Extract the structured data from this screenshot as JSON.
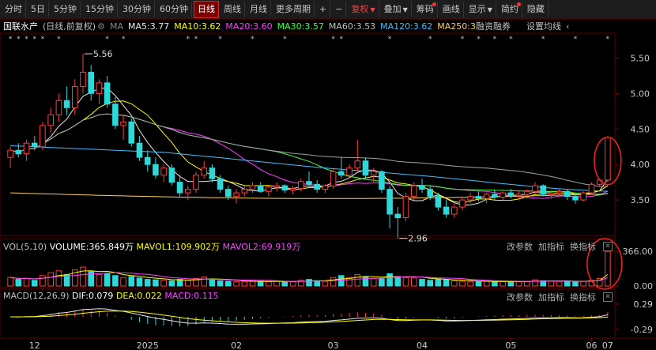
{
  "toolbar": {
    "periods": [
      "分时",
      "5日",
      "5分钟",
      "15分钟",
      "30分钟",
      "60分钟",
      "日线",
      "周线",
      "月线",
      "更多周期"
    ],
    "active_period": "日线",
    "plus": "+",
    "minus": "−",
    "restore_label": "复权",
    "overlay_label": "叠加",
    "chips_label": "筹码",
    "draw_label": "画线",
    "display_label": "显示",
    "simple_label": "简约",
    "hide_label": "隐藏"
  },
  "info": {
    "stock_name": "国联水产",
    "mode": "(日线,前复权)",
    "ma_label": "MA",
    "ma5": "MA5:3.77",
    "ma10": "MA10:3.62",
    "ma20": "MA20:3.60",
    "ma30": "MA30:3.57",
    "ma60": "MA60:3.53",
    "ma120": "MA120:3.62",
    "ma250": "MA250:3",
    "margin": "融资融券",
    "settings": "设置均线"
  },
  "colors": {
    "up": "#ff3c3c",
    "down": "#2ed8d8",
    "ma5": "#e8e8e8",
    "ma10": "#ffff00",
    "ma20": "#ff40ff",
    "ma30": "#40ff40",
    "ma60": "#a0a0a0",
    "ma120": "#40c0ff",
    "ma250": "#ffd060"
  },
  "chart_data": {
    "type": "candlestick",
    "y_ticks": [
      "5.50",
      "5.00",
      "4.50",
      "4.00",
      "3.50"
    ],
    "ylim": [
      3.0,
      5.85
    ],
    "x_labels": [
      "12",
      "2025",
      "02",
      "03",
      "04",
      "05",
      "06",
      "07"
    ],
    "annotations": [
      "5.56",
      "2.96"
    ],
    "ohlc": [
      [
        4.1,
        4.25,
        3.95,
        4.2
      ],
      [
        4.2,
        4.3,
        4.1,
        4.15
      ],
      [
        4.15,
        4.35,
        4.05,
        4.3
      ],
      [
        4.3,
        4.4,
        4.2,
        4.25
      ],
      [
        4.25,
        4.6,
        4.2,
        4.55
      ],
      [
        4.55,
        4.8,
        4.45,
        4.7
      ],
      [
        4.7,
        5.0,
        4.6,
        4.9
      ],
      [
        4.9,
        5.1,
        4.7,
        4.8
      ],
      [
        4.8,
        5.2,
        4.7,
        5.1
      ],
      [
        5.1,
        5.56,
        5.0,
        5.3
      ],
      [
        5.3,
        5.4,
        4.9,
        5.0
      ],
      [
        5.0,
        5.2,
        4.85,
        5.15
      ],
      [
        5.15,
        5.25,
        4.8,
        4.85
      ],
      [
        4.85,
        4.95,
        4.5,
        4.55
      ],
      [
        4.55,
        4.7,
        4.35,
        4.6
      ],
      [
        4.6,
        4.65,
        4.25,
        4.3
      ],
      [
        4.3,
        4.4,
        4.05,
        4.1
      ],
      [
        4.1,
        4.2,
        3.9,
        4.0
      ],
      [
        4.0,
        4.1,
        3.8,
        3.85
      ],
      [
        3.85,
        4.0,
        3.75,
        3.95
      ],
      [
        3.95,
        4.0,
        3.7,
        3.75
      ],
      [
        3.75,
        3.85,
        3.55,
        3.6
      ],
      [
        3.6,
        3.7,
        3.5,
        3.65
      ],
      [
        3.65,
        3.9,
        3.6,
        3.85
      ],
      [
        3.85,
        4.05,
        3.8,
        3.95
      ],
      [
        3.95,
        4.0,
        3.75,
        3.8
      ],
      [
        3.8,
        3.85,
        3.6,
        3.65
      ],
      [
        3.65,
        3.7,
        3.5,
        3.55
      ],
      [
        3.55,
        3.65,
        3.45,
        3.6
      ],
      [
        3.6,
        3.7,
        3.55,
        3.65
      ],
      [
        3.65,
        3.75,
        3.6,
        3.7
      ],
      [
        3.7,
        3.75,
        3.6,
        3.62
      ],
      [
        3.62,
        3.7,
        3.55,
        3.68
      ],
      [
        3.68,
        3.75,
        3.62,
        3.7
      ],
      [
        3.7,
        3.72,
        3.6,
        3.64
      ],
      [
        3.64,
        3.7,
        3.58,
        3.66
      ],
      [
        3.66,
        3.8,
        3.62,
        3.76
      ],
      [
        3.76,
        3.9,
        3.7,
        3.72
      ],
      [
        3.72,
        3.78,
        3.6,
        3.65
      ],
      [
        3.65,
        3.72,
        3.6,
        3.7
      ],
      [
        3.7,
        3.95,
        3.66,
        3.9
      ],
      [
        3.9,
        4.1,
        3.8,
        3.85
      ],
      [
        3.85,
        4.0,
        3.8,
        3.95
      ],
      [
        3.95,
        4.35,
        3.9,
        4.05
      ],
      [
        4.05,
        4.1,
        3.8,
        3.85
      ],
      [
        3.85,
        3.95,
        3.75,
        3.9
      ],
      [
        3.9,
        3.92,
        3.6,
        3.65
      ],
      [
        3.65,
        3.7,
        3.1,
        3.3
      ],
      [
        3.3,
        3.4,
        2.96,
        3.25
      ],
      [
        3.25,
        3.6,
        3.2,
        3.55
      ],
      [
        3.55,
        3.75,
        3.5,
        3.7
      ],
      [
        3.7,
        3.8,
        3.6,
        3.65
      ],
      [
        3.65,
        3.7,
        3.5,
        3.55
      ],
      [
        3.55,
        3.6,
        3.35,
        3.4
      ],
      [
        3.4,
        3.5,
        3.25,
        3.3
      ],
      [
        3.3,
        3.45,
        3.25,
        3.4
      ],
      [
        3.4,
        3.55,
        3.35,
        3.5
      ],
      [
        3.5,
        3.6,
        3.45,
        3.55
      ],
      [
        3.55,
        3.62,
        3.48,
        3.52
      ],
      [
        3.52,
        3.6,
        3.45,
        3.58
      ],
      [
        3.58,
        3.65,
        3.5,
        3.54
      ],
      [
        3.54,
        3.62,
        3.5,
        3.6
      ],
      [
        3.6,
        3.66,
        3.52,
        3.56
      ],
      [
        3.56,
        3.62,
        3.5,
        3.58
      ],
      [
        3.58,
        3.65,
        3.55,
        3.62
      ],
      [
        3.62,
        3.75,
        3.58,
        3.7
      ],
      [
        3.7,
        3.72,
        3.55,
        3.58
      ],
      [
        3.58,
        3.64,
        3.52,
        3.6
      ],
      [
        3.6,
        3.66,
        3.55,
        3.62
      ],
      [
        3.62,
        3.65,
        3.5,
        3.55
      ],
      [
        3.55,
        3.6,
        3.45,
        3.5
      ],
      [
        3.5,
        3.62,
        3.48,
        3.6
      ],
      [
        3.6,
        3.75,
        3.58,
        3.72
      ],
      [
        3.72,
        3.8,
        3.68,
        3.78
      ],
      [
        3.78,
        4.4,
        3.75,
        4.38
      ]
    ],
    "volume": {
      "label": "VOL(5,10)",
      "volume": "VOLUME:365.849万",
      "mavol1": "MAVOL1:109.902万",
      "mavol2": "MAVOL2:69.919万",
      "y_ticks": [
        "366.00",
        "0.00"
      ],
      "values": [
        90,
        70,
        80,
        60,
        110,
        140,
        160,
        120,
        170,
        200,
        150,
        120,
        130,
        110,
        90,
        100,
        85,
        70,
        65,
        60,
        55,
        70,
        60,
        80,
        95,
        70,
        55,
        50,
        45,
        48,
        52,
        50,
        46,
        50,
        44,
        46,
        60,
        70,
        55,
        50,
        90,
        110,
        90,
        120,
        95,
        80,
        75,
        130,
        100,
        90,
        85,
        70,
        60,
        75,
        65,
        55,
        50,
        48,
        45,
        50,
        46,
        48,
        44,
        46,
        50,
        65,
        55,
        50,
        48,
        52,
        46,
        50,
        60,
        80,
        365
      ]
    },
    "macd": {
      "label": "MACD(12,26,9)",
      "dif": "DIF:0.079",
      "dea": "DEA:0.022",
      "macd": "MACD:0.115",
      "y_ticks": [
        "0.29",
        "-0.29"
      ]
    }
  },
  "panel_buttons": {
    "params": "改参数",
    "indicator": "加指标",
    "switch": "换指标"
  }
}
